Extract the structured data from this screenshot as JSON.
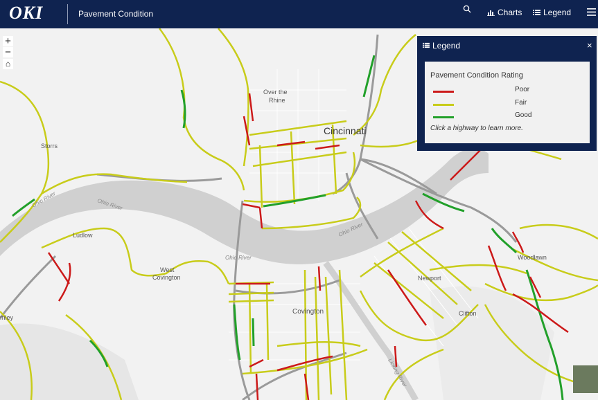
{
  "header": {
    "logo": "OKI",
    "title": "Pavement Condition",
    "charts_label": "Charts",
    "legend_label": "Legend"
  },
  "legend": {
    "panel_title": "Legend",
    "section_title": "Pavement Condition Rating",
    "items": [
      {
        "label": "Poor",
        "color": "#cc1a1a"
      },
      {
        "label": "Fair",
        "color": "#c8cc1a"
      },
      {
        "label": "Good",
        "color": "#22a02a"
      }
    ],
    "note": "Click a highway to learn more."
  },
  "map": {
    "river_color": "#cfcfcf",
    "land_color": "#f2f2f2",
    "labels": {
      "over_the_rhine_1": "Over the",
      "over_the_rhine_2": "Rhine",
      "cincinnati": "Cincinnati",
      "storrs": "Storrs",
      "ohio_river_1": "Ohio River",
      "ohio_river_2": "Ohio River",
      "ohio_river_3": "Ohio River",
      "ohio_river_4": "Ohio River",
      "ludlow": "Ludlow",
      "west_covington_1": "West",
      "west_covington_2": "Covington",
      "covington": "Covington",
      "newport": "Newport",
      "woodlawn": "Woodlawn",
      "clifton": "Clifton",
      "bromley": "mley",
      "licking_river": "Licking River"
    }
  }
}
